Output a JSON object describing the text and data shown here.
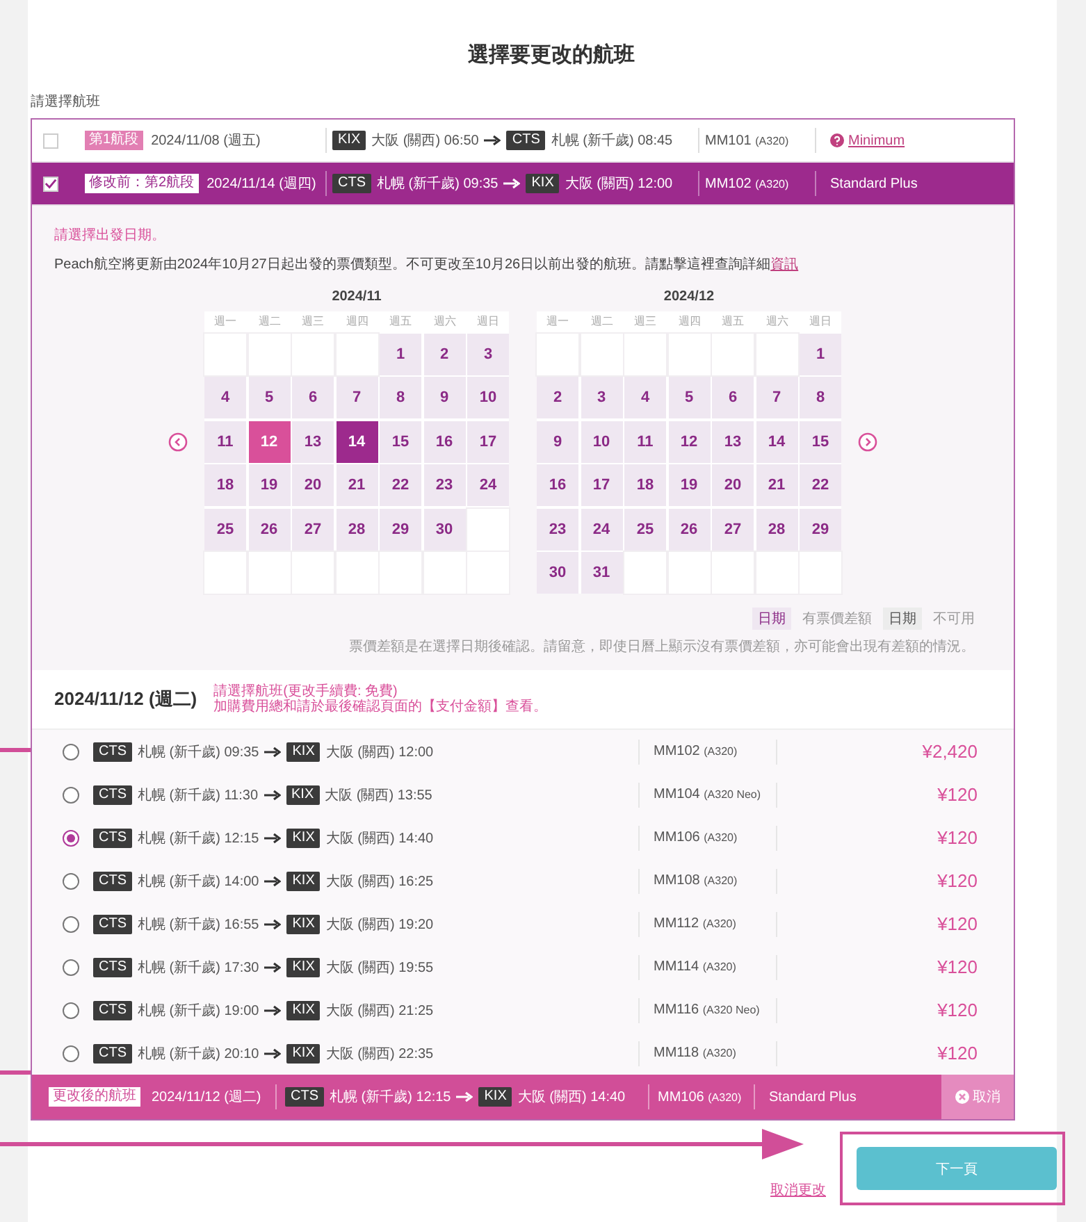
{
  "page_title": "選擇要更改的航班",
  "prompt": "請選擇航班",
  "segments": [
    {
      "checked": false,
      "tag": "第1航段",
      "date": "2024/11/08 (週五)",
      "from_code": "KIX",
      "from": "大阪 (關西) 06:50",
      "to_code": "CTS",
      "to": "札幌 (新千歲) 08:45",
      "flight": "MM101",
      "aircraft": "(A320)",
      "fare": {
        "kind": "help-link",
        "text": "Minimum"
      }
    },
    {
      "checked": true,
      "tag": "修改前：第2航段",
      "date": "2024/11/14 (週四)",
      "from_code": "CTS",
      "from": "札幌 (新千歲) 09:35",
      "to_code": "KIX",
      "to": "大阪 (關西) 12:00",
      "flight": "MM102",
      "aircraft": "(A320)",
      "fare": {
        "kind": "text",
        "text": "Standard Plus"
      }
    }
  ],
  "calendar": {
    "hint": "請選擇出發日期。",
    "notice": "Peach航空將更新由2024年10月27日起出發的票價類型。不可更改至10月26日以前出發的航班。請點擊這裡查詢詳細",
    "notice_link": "資訊",
    "months": [
      {
        "title": "2024/11",
        "weekdays": [
          "週一",
          "週二",
          "週三",
          "週四",
          "週五",
          "週六",
          "週日"
        ],
        "cells": [
          {
            "kind": "blank"
          },
          {
            "kind": "blank"
          },
          {
            "kind": "blank"
          },
          {
            "kind": "blank"
          },
          {
            "kind": "day",
            "day": "1",
            "selected": false
          },
          {
            "kind": "day",
            "day": "2",
            "selected": false
          },
          {
            "kind": "day",
            "day": "3",
            "selected": false
          },
          {
            "kind": "day",
            "day": "4",
            "selected": false
          },
          {
            "kind": "day",
            "day": "5",
            "selected": false
          },
          {
            "kind": "day",
            "day": "6",
            "selected": false
          },
          {
            "kind": "day",
            "day": "7",
            "selected": false
          },
          {
            "kind": "day",
            "day": "8",
            "selected": false
          },
          {
            "kind": "day",
            "day": "9",
            "selected": false
          },
          {
            "kind": "day",
            "day": "10",
            "selected": false
          },
          {
            "kind": "day",
            "day": "11",
            "selected": false
          },
          {
            "kind": "day",
            "day": "12",
            "selected": true
          },
          {
            "kind": "day",
            "day": "13",
            "selected": false
          },
          {
            "kind": "original-day",
            "day": "14",
            "selected": false
          },
          {
            "kind": "day",
            "day": "15",
            "selected": false
          },
          {
            "kind": "day",
            "day": "16",
            "selected": false
          },
          {
            "kind": "day",
            "day": "17",
            "selected": false
          },
          {
            "kind": "day",
            "day": "18",
            "selected": false
          },
          {
            "kind": "day",
            "day": "19",
            "selected": false
          },
          {
            "kind": "day",
            "day": "20",
            "selected": false
          },
          {
            "kind": "day",
            "day": "21",
            "selected": false
          },
          {
            "kind": "day",
            "day": "22",
            "selected": false
          },
          {
            "kind": "day",
            "day": "23",
            "selected": false
          },
          {
            "kind": "day",
            "day": "24",
            "selected": false
          },
          {
            "kind": "day",
            "day": "25",
            "selected": false
          },
          {
            "kind": "day",
            "day": "26",
            "selected": false
          },
          {
            "kind": "day",
            "day": "27",
            "selected": false
          },
          {
            "kind": "day",
            "day": "28",
            "selected": false
          },
          {
            "kind": "day",
            "day": "29",
            "selected": false
          },
          {
            "kind": "day",
            "day": "30",
            "selected": false
          },
          {
            "kind": "blank"
          },
          {
            "kind": "blank"
          },
          {
            "kind": "blank"
          },
          {
            "kind": "blank"
          },
          {
            "kind": "blank"
          },
          {
            "kind": "blank"
          },
          {
            "kind": "blank"
          },
          {
            "kind": "blank"
          }
        ]
      },
      {
        "title": "2024/12",
        "weekdays": [
          "週一",
          "週二",
          "週三",
          "週四",
          "週五",
          "週六",
          "週日"
        ],
        "cells": [
          {
            "kind": "blank"
          },
          {
            "kind": "blank"
          },
          {
            "kind": "blank"
          },
          {
            "kind": "blank"
          },
          {
            "kind": "blank"
          },
          {
            "kind": "blank"
          },
          {
            "kind": "day",
            "day": "1",
            "selected": false
          },
          {
            "kind": "day",
            "day": "2",
            "selected": false
          },
          {
            "kind": "day",
            "day": "3",
            "selected": false
          },
          {
            "kind": "day",
            "day": "4",
            "selected": false
          },
          {
            "kind": "day",
            "day": "5",
            "selected": false
          },
          {
            "kind": "day",
            "day": "6",
            "selected": false
          },
          {
            "kind": "day",
            "day": "7",
            "selected": false
          },
          {
            "kind": "day",
            "day": "8",
            "selected": false
          },
          {
            "kind": "day",
            "day": "9",
            "selected": false
          },
          {
            "kind": "day",
            "day": "10",
            "selected": false
          },
          {
            "kind": "day",
            "day": "11",
            "selected": false
          },
          {
            "kind": "day",
            "day": "12",
            "selected": false
          },
          {
            "kind": "day",
            "day": "13",
            "selected": false
          },
          {
            "kind": "day",
            "day": "14",
            "selected": false
          },
          {
            "kind": "day",
            "day": "15",
            "selected": false
          },
          {
            "kind": "day",
            "day": "16",
            "selected": false
          },
          {
            "kind": "day",
            "day": "17",
            "selected": false
          },
          {
            "kind": "day",
            "day": "18",
            "selected": false
          },
          {
            "kind": "day",
            "day": "19",
            "selected": false
          },
          {
            "kind": "day",
            "day": "20",
            "selected": false
          },
          {
            "kind": "day",
            "day": "21",
            "selected": false
          },
          {
            "kind": "day",
            "day": "22",
            "selected": false
          },
          {
            "kind": "day",
            "day": "23",
            "selected": false
          },
          {
            "kind": "day",
            "day": "24",
            "selected": false
          },
          {
            "kind": "day",
            "day": "25",
            "selected": false
          },
          {
            "kind": "day",
            "day": "26",
            "selected": false
          },
          {
            "kind": "day",
            "day": "27",
            "selected": false
          },
          {
            "kind": "day",
            "day": "28",
            "selected": false
          },
          {
            "kind": "day",
            "day": "29",
            "selected": false
          },
          {
            "kind": "day",
            "day": "30",
            "selected": false
          },
          {
            "kind": "day",
            "day": "31",
            "selected": false
          },
          {
            "kind": "blank"
          },
          {
            "kind": "blank"
          },
          {
            "kind": "blank"
          },
          {
            "kind": "blank"
          },
          {
            "kind": "blank"
          }
        ]
      }
    ],
    "legend": [
      {
        "kind": "available-sample",
        "label": "日期"
      },
      {
        "kind": "text",
        "label": "有票價差額"
      },
      {
        "kind": "unavailable-sample",
        "label": "日期"
      },
      {
        "kind": "text",
        "label": "不可用"
      }
    ],
    "note": "票價差額是在選擇日期後確認。請留意，即使日曆上顯示沒有票價差額，亦可能會出現有差額的情況。"
  },
  "options": {
    "date": "2024/11/12 (週二)",
    "notes": [
      "請選擇航班(更改手續費: 免費)",
      "加購費用總和請於最後確認頁面的【支付金額】查看。"
    ],
    "flights": [
      {
        "selected": false,
        "from_code": "CTS",
        "from": "札幌 (新千歲) 09:35",
        "to_code": "KIX",
        "to": "大阪 (關西) 12:00",
        "flight": "MM102",
        "aircraft": "(A320)",
        "price": "¥2,420"
      },
      {
        "selected": false,
        "from_code": "CTS",
        "from": "札幌 (新千歲) 11:30",
        "to_code": "KIX",
        "to": "大阪 (關西) 13:55",
        "flight": "MM104",
        "aircraft": "(A320 Neo)",
        "price": "¥120"
      },
      {
        "selected": true,
        "from_code": "CTS",
        "from": "札幌 (新千歲) 12:15",
        "to_code": "KIX",
        "to": "大阪 (關西) 14:40",
        "flight": "MM106",
        "aircraft": "(A320)",
        "price": "¥120"
      },
      {
        "selected": false,
        "from_code": "CTS",
        "from": "札幌 (新千歲) 14:00",
        "to_code": "KIX",
        "to": "大阪 (關西) 16:25",
        "flight": "MM108",
        "aircraft": "(A320)",
        "price": "¥120"
      },
      {
        "selected": false,
        "from_code": "CTS",
        "from": "札幌 (新千歲) 16:55",
        "to_code": "KIX",
        "to": "大阪 (關西) 19:20",
        "flight": "MM112",
        "aircraft": "(A320)",
        "price": "¥120"
      },
      {
        "selected": false,
        "from_code": "CTS",
        "from": "札幌 (新千歲) 17:30",
        "to_code": "KIX",
        "to": "大阪 (關西) 19:55",
        "flight": "MM114",
        "aircraft": "(A320)",
        "price": "¥120"
      },
      {
        "selected": false,
        "from_code": "CTS",
        "from": "札幌 (新千歲) 19:00",
        "to_code": "KIX",
        "to": "大阪 (關西) 21:25",
        "flight": "MM116",
        "aircraft": "(A320 Neo)",
        "price": "¥120"
      },
      {
        "selected": false,
        "from_code": "CTS",
        "from": "札幌 (新千歲) 20:10",
        "to_code": "KIX",
        "to": "大阪 (關西) 22:35",
        "flight": "MM118",
        "aircraft": "(A320)",
        "price": "¥120"
      }
    ]
  },
  "summary": {
    "tag": "更改後的航班",
    "date": "2024/11/12 (週二)",
    "from_code": "CTS",
    "from": "札幌 (新千歲) 12:15",
    "to_code": "KIX",
    "to": "大阪 (關西) 14:40",
    "flight": "MM106",
    "aircraft": "(A320)",
    "fare": "Standard Plus",
    "cancel": "取消"
  },
  "actions": {
    "cancel_link": "取消更改",
    "next": "下一頁"
  }
}
